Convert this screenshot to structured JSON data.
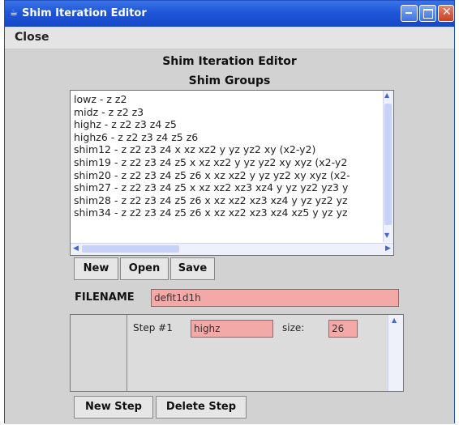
{
  "window": {
    "title": "Shim Iteration Editor",
    "title_icon": "java-cup-icon"
  },
  "menu": {
    "close_label": "Close"
  },
  "main": {
    "title": "Shim Iteration Editor",
    "subtitle": "Shim Groups"
  },
  "shim_groups": [
    "lowz - z z2",
    "midz - z z2 z3",
    "highz - z z2 z3 z4 z5",
    "highz6 - z z2 z3 z4 z5 z6",
    "shim12 - z z2 z3 z4 x xz xz2 y yz yz2 xy (x2-y2)",
    "shim19 - z z2 z3 z4 z5 x xz xz2 y yz yz2 xy xyz (x2-y2",
    "shim20 - z z2 z3 z4 z5 z6 x xz xz2 y yz yz2 xy xyz (x2-",
    "shim27 - z z2 z3 z4 z5 x xz xz2 xz3 xz4 y yz yz2 yz3 y",
    "shim28 - z z2 z3 z4 z5 z6 x xz xz2 xz3 xz4 y yz yz2 yz",
    "shim34 - z z2 z3 z4 z5 z6 x xz xz2 xz3 xz4 xz5 y yz yz"
  ],
  "file_buttons": {
    "new": "New",
    "open": "Open",
    "save": "Save"
  },
  "filename": {
    "label": "FILENAME",
    "value": "defit1d1h"
  },
  "step": {
    "label": "Step #1",
    "group_value": "highz",
    "size_label": "size:",
    "size_value": "26"
  },
  "step_buttons": {
    "new_step": "New Step",
    "delete_step": "Delete Step"
  },
  "colors": {
    "titlebar": "#1e56d8",
    "field_bg": "#f4a9a9",
    "panel_bg": "#d2d2d2"
  }
}
